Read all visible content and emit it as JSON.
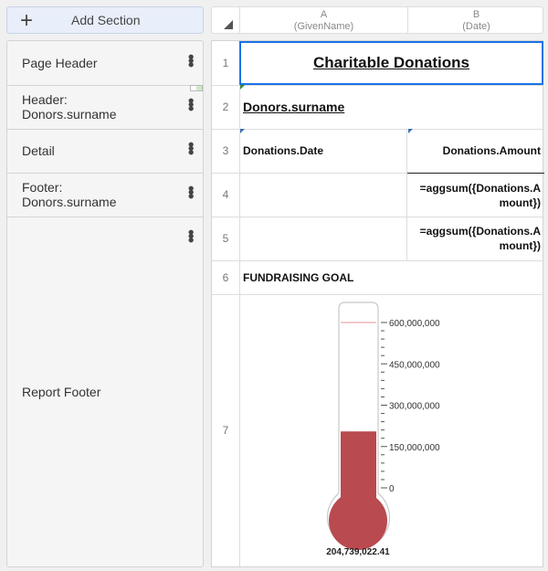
{
  "left_panel": {
    "add_section": "Add Section",
    "sections": [
      {
        "label": "Page Header"
      },
      {
        "label": "Header:\nDonors.surname"
      },
      {
        "label": "Detail"
      },
      {
        "label": "Footer:\nDonors.surname"
      },
      {
        "label": "Report Footer"
      }
    ]
  },
  "columns": [
    {
      "letter": "A",
      "field": "(GivenName)"
    },
    {
      "letter": "B",
      "field": "(Date)"
    }
  ],
  "rows": [
    {
      "num": "1",
      "a": "Charitable Donations",
      "b": ""
    },
    {
      "num": "2",
      "a": "Donors.surname",
      "b": ""
    },
    {
      "num": "3",
      "a": "Donations.Date",
      "b": "Donations.Amount"
    },
    {
      "num": "4",
      "a": "",
      "b": "=aggsum({Donations.Amount})"
    },
    {
      "num": "5",
      "a": "",
      "b": "=aggsum({Donations.Amount})"
    },
    {
      "num": "6",
      "a": "FUNDRAISING GOAL",
      "b": ""
    },
    {
      "num": "7",
      "a": "",
      "b": ""
    }
  ],
  "chart_data": {
    "type": "thermometer",
    "value": 204739022.41,
    "value_label": "204,739,022.41",
    "goal": 600000000,
    "ylim": [
      0,
      600000000
    ],
    "tick_labels": [
      "0",
      "150,000,000",
      "300,000,000",
      "450,000,000",
      "600,000,000"
    ],
    "ticks": [
      0,
      150000000,
      300000000,
      450000000,
      600000000
    ],
    "fill_color": "#b94a4f",
    "goal_color": "#f0b8bb"
  },
  "colors": {
    "selection": "#1a73e8",
    "marker": "#3b6fb0"
  }
}
